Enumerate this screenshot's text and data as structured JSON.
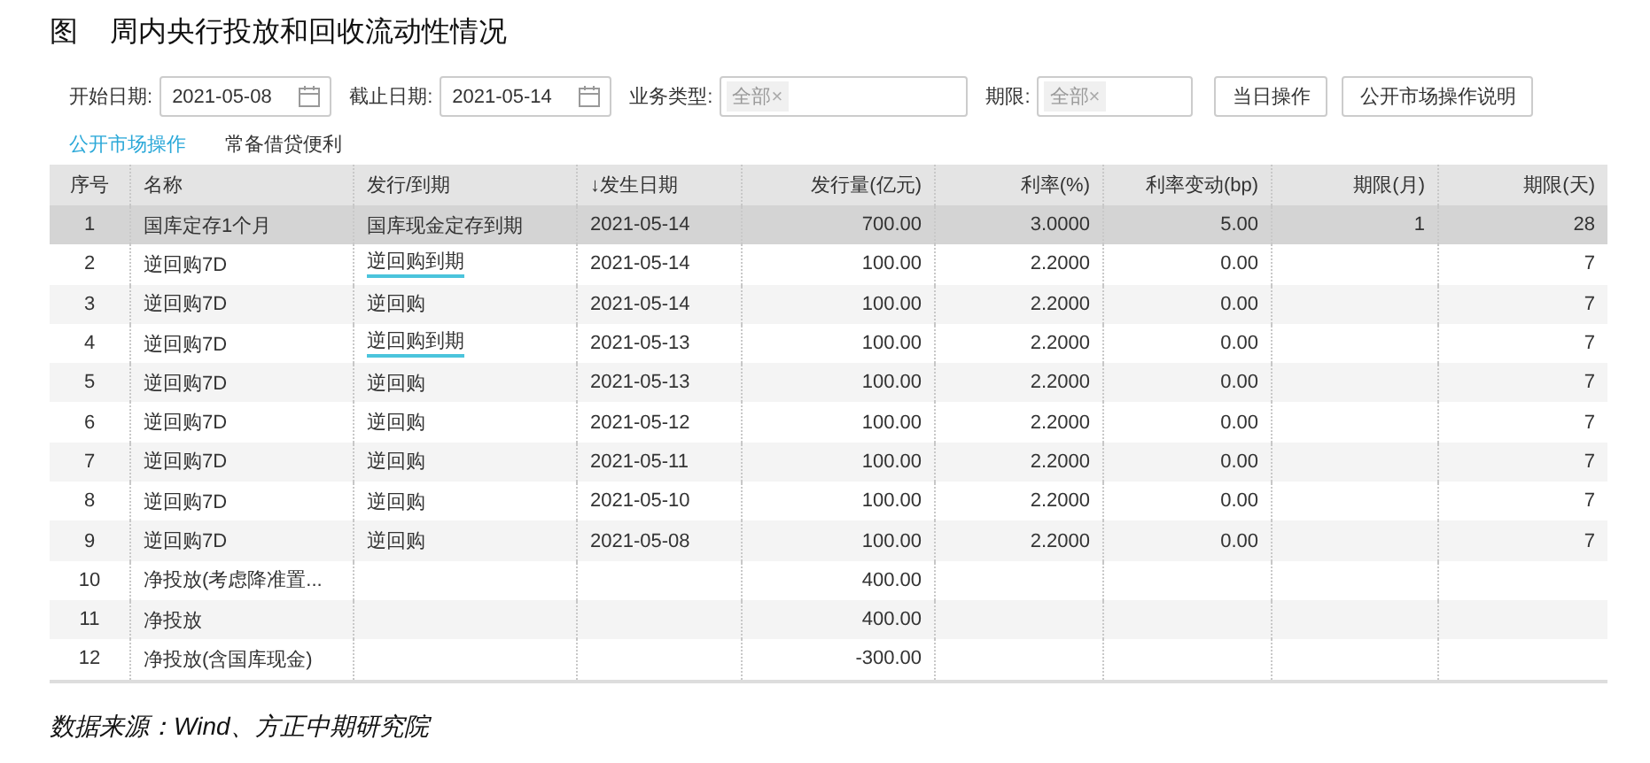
{
  "figure": {
    "label": "图",
    "title": "周内央行投放和回收流动性情况"
  },
  "filters": [
    {
      "kind": "date",
      "label": "开始日期:",
      "value": "2021-05-08"
    },
    {
      "kind": "date",
      "label": "截止日期:",
      "value": "2021-05-14"
    },
    {
      "kind": "select",
      "label": "业务类型:",
      "chips": [
        {
          "text": "全部",
          "remove": "×"
        }
      ]
    },
    {
      "kind": "select",
      "label": "期限:",
      "chips": [
        {
          "text": "全部",
          "remove": "×"
        }
      ]
    }
  ],
  "buttons": [
    "当日操作",
    "公开市场操作说明"
  ],
  "tabs": [
    {
      "label": "公开市场操作",
      "selected": true
    },
    {
      "label": "常备借贷便利",
      "selected": false
    }
  ],
  "table": {
    "columns": [
      "序号",
      "名称",
      "发行/到期",
      "↓发生日期",
      "发行量(亿元)",
      "利率(%)",
      "利率变动(bp)",
      "期限(月)",
      "期限(天)"
    ],
    "rows": [
      {
        "selected": true,
        "linked": false,
        "cells": [
          "1",
          "国库定存1个月",
          "国库现金定存到期",
          "2021-05-14",
          "700.00",
          "3.0000",
          "5.00",
          "1",
          "28"
        ]
      },
      {
        "selected": false,
        "linked": true,
        "cells": [
          "2",
          "逆回购7D",
          "逆回购到期",
          "2021-05-14",
          "100.00",
          "2.2000",
          "0.00",
          "",
          "7"
        ]
      },
      {
        "selected": false,
        "linked": false,
        "cells": [
          "3",
          "逆回购7D",
          "逆回购",
          "2021-05-14",
          "100.00",
          "2.2000",
          "0.00",
          "",
          "7"
        ]
      },
      {
        "selected": false,
        "linked": true,
        "cells": [
          "4",
          "逆回购7D",
          "逆回购到期",
          "2021-05-13",
          "100.00",
          "2.2000",
          "0.00",
          "",
          "7"
        ]
      },
      {
        "selected": false,
        "linked": false,
        "cells": [
          "5",
          "逆回购7D",
          "逆回购",
          "2021-05-13",
          "100.00",
          "2.2000",
          "0.00",
          "",
          "7"
        ]
      },
      {
        "selected": false,
        "linked": false,
        "cells": [
          "6",
          "逆回购7D",
          "逆回购",
          "2021-05-12",
          "100.00",
          "2.2000",
          "0.00",
          "",
          "7"
        ]
      },
      {
        "selected": false,
        "linked": false,
        "cells": [
          "7",
          "逆回购7D",
          "逆回购",
          "2021-05-11",
          "100.00",
          "2.2000",
          "0.00",
          "",
          "7"
        ]
      },
      {
        "selected": false,
        "linked": false,
        "cells": [
          "8",
          "逆回购7D",
          "逆回购",
          "2021-05-10",
          "100.00",
          "2.2000",
          "0.00",
          "",
          "7"
        ]
      },
      {
        "selected": false,
        "linked": false,
        "cells": [
          "9",
          "逆回购7D",
          "逆回购",
          "2021-05-08",
          "100.00",
          "2.2000",
          "0.00",
          "",
          "7"
        ]
      },
      {
        "selected": false,
        "cells": [
          "10",
          "净投放(考虑降准置...",
          "",
          "",
          "400.00",
          "",
          "",
          "",
          ""
        ]
      },
      {
        "selected": false,
        "cells": [
          "11",
          "净投放",
          "",
          "",
          "400.00",
          "",
          "",
          "",
          ""
        ]
      },
      {
        "selected": false,
        "cells": [
          "12",
          "净投放(含国库现金)",
          "",
          "",
          "-300.00",
          "",
          "",
          "",
          ""
        ]
      }
    ]
  },
  "source": "数据来源：Wind、方正中期研究院"
}
